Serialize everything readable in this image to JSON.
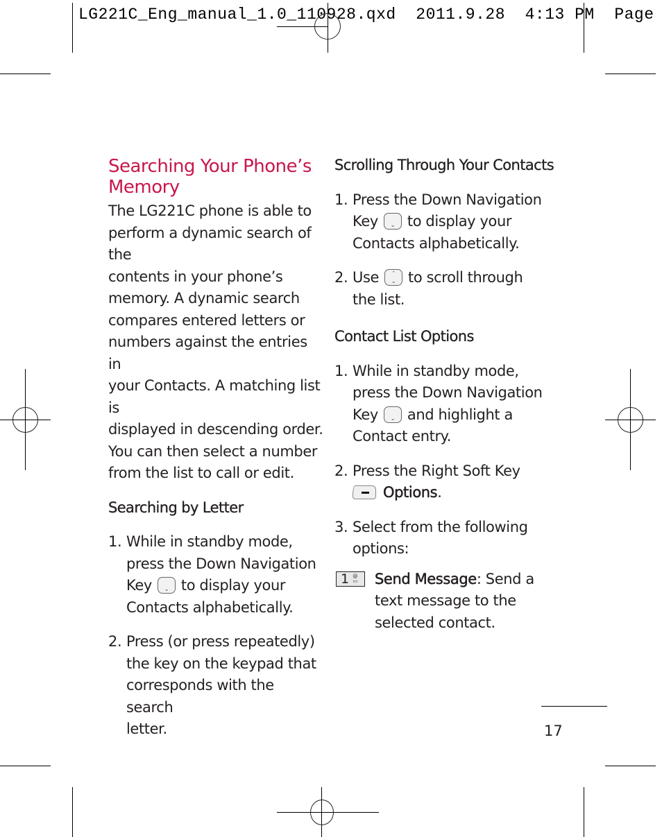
{
  "slug": {
    "text": "LG221C_Eng_manual_1.0_110928.qxd  2011.9.28  4:13 PM  Page"
  },
  "left_column": {
    "title_line1": "Searching Your Phone’s",
    "title_line2": "Memory",
    "intro_lines": [
      "The LG221C phone is able to",
      "perform a dynamic search of the",
      "contents in your phone’s",
      "memory. A dynamic search",
      "compares entered letters or",
      "numbers against the entries in",
      "your Contacts. A matching list is",
      "displayed in descending order.",
      "You can then select a number",
      "from the list to call or edit."
    ],
    "subhead": "Searching by Letter",
    "steps": [
      {
        "num": "1.",
        "line1": "While in standby mode,",
        "line2": "press the Down Navigation",
        "line3_pre": "Key",
        "line3_icon": "down-navigation-key-icon",
        "line3_post": "to display your",
        "line4": "Contacts alphabetically."
      },
      {
        "num": "2.",
        "lines": [
          "Press (or press repeatedly)",
          "the key on the keypad that",
          "corresponds with the search",
          "letter."
        ]
      }
    ]
  },
  "right_column": {
    "section1": {
      "subhead": "Scrolling Through Your Contacts",
      "step1": {
        "num": "1.",
        "line1": "Press the Down Navigation",
        "line2_pre": "Key",
        "line2_icon": "down-navigation-key-icon",
        "line2_post": "to display your",
        "line3": "Contacts alphabetically."
      },
      "step2": {
        "num": "2.",
        "line1_pre": "Use",
        "line1_icon": "up-down-navigation-key-icon",
        "line1_post": "to scroll through",
        "line2": "the list."
      }
    },
    "section2": {
      "subhead": "Contact List Options",
      "step1": {
        "num": "1.",
        "line1": "While in standby mode,",
        "line2": "press the Down Navigation",
        "line3_pre": "Key",
        "line3_icon": "down-navigation-key-icon",
        "line3_post": "and highlight a",
        "line4": "Contact entry."
      },
      "step2": {
        "num": "2.",
        "line1": "Press the Right Soft Key",
        "line2_icon": "right-soft-key-icon",
        "line2_bold": "Options",
        "line2_post": "."
      },
      "step3": {
        "num": "3.",
        "line1": "Select from the following",
        "line2": "options:"
      },
      "option": {
        "key_number": "1",
        "key_icon": "message-key-icon",
        "label_bold": "Send Message",
        "label_post": ": Send a",
        "line2": "text message to the",
        "line3": "selected contact."
      }
    }
  },
  "footer": {
    "page_number": "17"
  },
  "colors": {
    "title_accent": "#c8174a",
    "body_text": "#231f20"
  }
}
